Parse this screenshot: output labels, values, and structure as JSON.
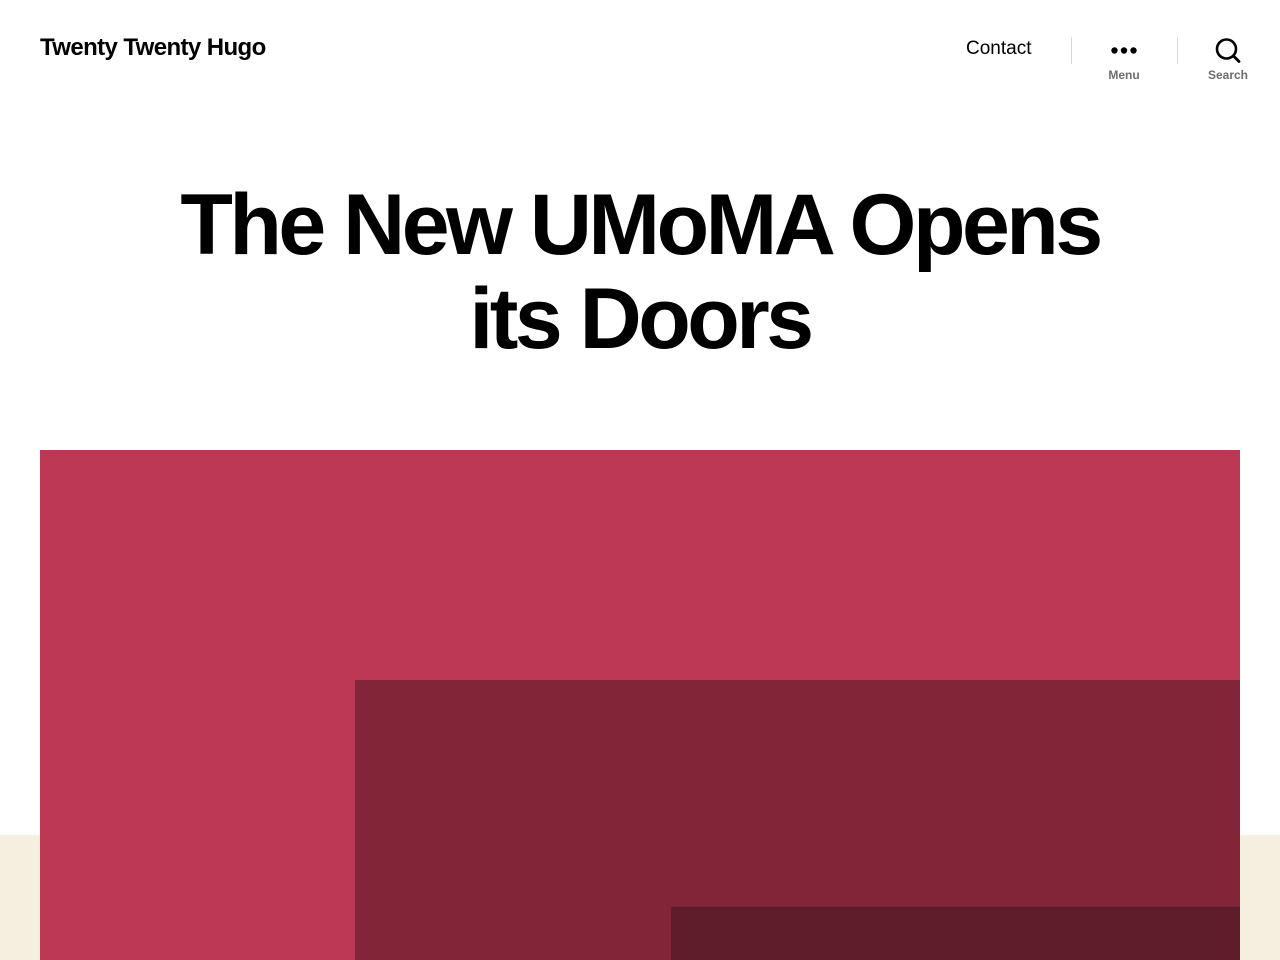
{
  "header": {
    "site_title": "Twenty Twenty Hugo",
    "nav": {
      "contact_label": "Contact"
    },
    "menu_toggle": {
      "label": "Menu",
      "icon": "ellipsis-icon"
    },
    "search_toggle": {
      "label": "Search",
      "icon": "search-icon"
    }
  },
  "article": {
    "title": "The New UMoMA Opens its Doors"
  },
  "featured_image": {
    "colors": {
      "base": "#bd3854",
      "mid": "#822538",
      "dark": "#5f1c2b"
    }
  },
  "colors": {
    "background": "#ffffff",
    "footer_band": "#f5efe0",
    "text": "#000000",
    "muted_text": "#6d6d6d",
    "divider": "#dcd7ca"
  }
}
